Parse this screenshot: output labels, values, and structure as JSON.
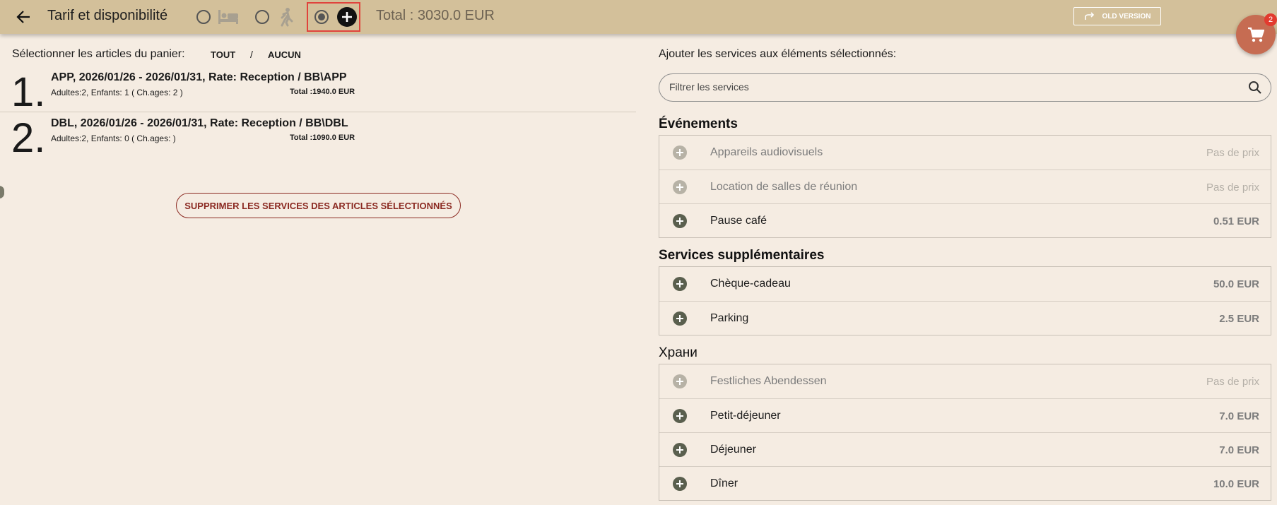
{
  "header": {
    "title": "Tarif et disponibilité",
    "total": "Total : 3030.0 EUR",
    "old_version_label": "OLD VERSION",
    "cart_count": "2",
    "modes": [
      {
        "icon": "bed-icon",
        "selected": false
      },
      {
        "icon": "walking-person-icon",
        "selected": false
      },
      {
        "icon": "add-icon",
        "selected": true
      }
    ]
  },
  "left": {
    "select_label": "Sélectionner les articles du panier:",
    "select_all": "TOUT",
    "separator": "/",
    "select_none": "AUCUN",
    "items": [
      {
        "number": "1.",
        "name": "APP, 2026/01/26 - 2026/01/31, Rate: Reception / BB\\APP",
        "guests": "Adultes:2, Enfants: 1 ( Ch.ages: 2 )",
        "total": "Total :1940.0 EUR"
      },
      {
        "number": "2.",
        "name": "DBL, 2026/01/26 - 2026/01/31, Rate: Reception / BB\\DBL",
        "guests": "Adultes:2, Enfants: 0 ( Ch.ages: )",
        "total": "Total :1090.0 EUR"
      }
    ],
    "remove_button": "SUPPRIMER LES SERVICES DES ARTICLES SÉLECTIONNÉS"
  },
  "right": {
    "add_label": "Ajouter les services aux éléments sélectionnés:",
    "filter_placeholder": "Filtrer les services",
    "sections": [
      {
        "title": "Événements",
        "services": [
          {
            "name": "Appareils audiovisuels",
            "price": "Pas de prix",
            "enabled": false
          },
          {
            "name": "Location de salles de réunion",
            "price": "Pas de prix",
            "enabled": false
          },
          {
            "name": "Pause café",
            "price": "0.51 EUR",
            "enabled": true
          }
        ]
      },
      {
        "title": "Services supplémentaires",
        "services": [
          {
            "name": "Chèque-cadeau",
            "price": "50.0 EUR",
            "enabled": true
          },
          {
            "name": "Parking",
            "price": "2.5 EUR",
            "enabled": true
          }
        ]
      },
      {
        "title": "Храни",
        "services": [
          {
            "name": "Festliches Abendessen",
            "price": "Pas de prix",
            "enabled": false
          },
          {
            "name": "Petit-déjeuner",
            "price": "7.0 EUR",
            "enabled": true
          },
          {
            "name": "Déjeuner",
            "price": "7.0 EUR",
            "enabled": true
          },
          {
            "name": "Dîner",
            "price": "10.0 EUR",
            "enabled": true
          }
        ]
      }
    ]
  },
  "colors": {
    "header_bg": "#d3c09a",
    "page_bg": "#f5ece2",
    "cart_fab": "#c66c52",
    "accent_red": "#8b2a22",
    "highlight": "#e0433c"
  }
}
